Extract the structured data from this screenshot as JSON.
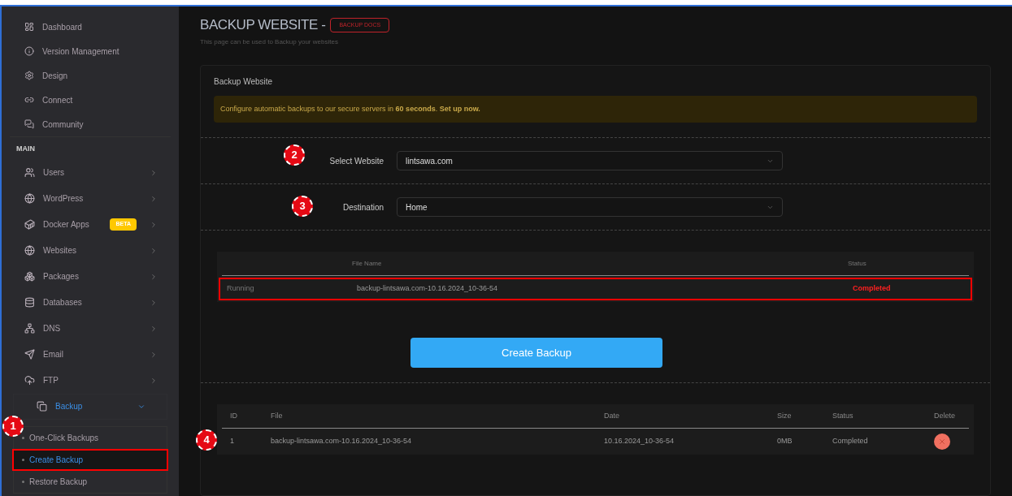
{
  "sidebar": {
    "top_items": [
      {
        "label": "Dashboard"
      },
      {
        "label": "Version Management"
      },
      {
        "label": "Design"
      },
      {
        "label": "Connect"
      },
      {
        "label": "Community"
      }
    ],
    "section_title": "MAIN",
    "items": [
      {
        "label": "Users",
        "expanded": false,
        "selected": false
      },
      {
        "label": "WordPress",
        "expanded": false,
        "selected": false
      },
      {
        "label": "Docker Apps",
        "badge": "BETA",
        "expanded": false,
        "selected": false
      },
      {
        "label": "Websites",
        "expanded": false,
        "selected": false
      },
      {
        "label": "Packages",
        "expanded": false,
        "selected": false
      },
      {
        "label": "Databases",
        "expanded": false,
        "selected": false
      },
      {
        "label": "DNS",
        "expanded": false,
        "selected": false
      },
      {
        "label": "Email",
        "expanded": false,
        "selected": false
      },
      {
        "label": "FTP",
        "expanded": false,
        "selected": false
      },
      {
        "label": "Backup",
        "expanded": true,
        "selected": true,
        "children": [
          {
            "label": "One-Click Backups",
            "selected": false,
            "highlighted": false,
            "marker": "1"
          },
          {
            "label": "Create Backup",
            "selected": true,
            "highlighted": true
          },
          {
            "label": "Restore Backup",
            "selected": false,
            "highlighted": false
          }
        ]
      }
    ]
  },
  "page": {
    "title": "BACKUP WEBSITE -",
    "docs_button": "BACKUP DOCS",
    "subtitle": "This page can be used to Backup your websites"
  },
  "card": {
    "title": "Backup Website",
    "notice": "Configure automatic backups to our secure servers in **60 seconds**. **Set up now.**",
    "form": [
      {
        "label": "Select Website",
        "value": "lintsawa.com",
        "marker": "2"
      },
      {
        "label": "Destination",
        "value": "Home",
        "marker": "3"
      }
    ],
    "progress_table": {
      "file_header": "File Name",
      "status_header": "Status",
      "rows": [
        {
          "state": "Running",
          "file": "backup-lintsawa.com-10.16.2024_10-36-54",
          "status": "Completed",
          "highlighted": true
        }
      ]
    },
    "create_button": "Create Backup",
    "backups_table": {
      "columns": [
        "ID",
        "File",
        "Date",
        "Size",
        "Status",
        "Delete"
      ],
      "rows": [
        {
          "id": "1",
          "file": "backup-lintsawa.com-10.16.2024_10-36-54",
          "date": "10.16.2024_10-36-54",
          "size": "0MB",
          "status": "Completed",
          "marker": "4"
        }
      ]
    }
  }
}
